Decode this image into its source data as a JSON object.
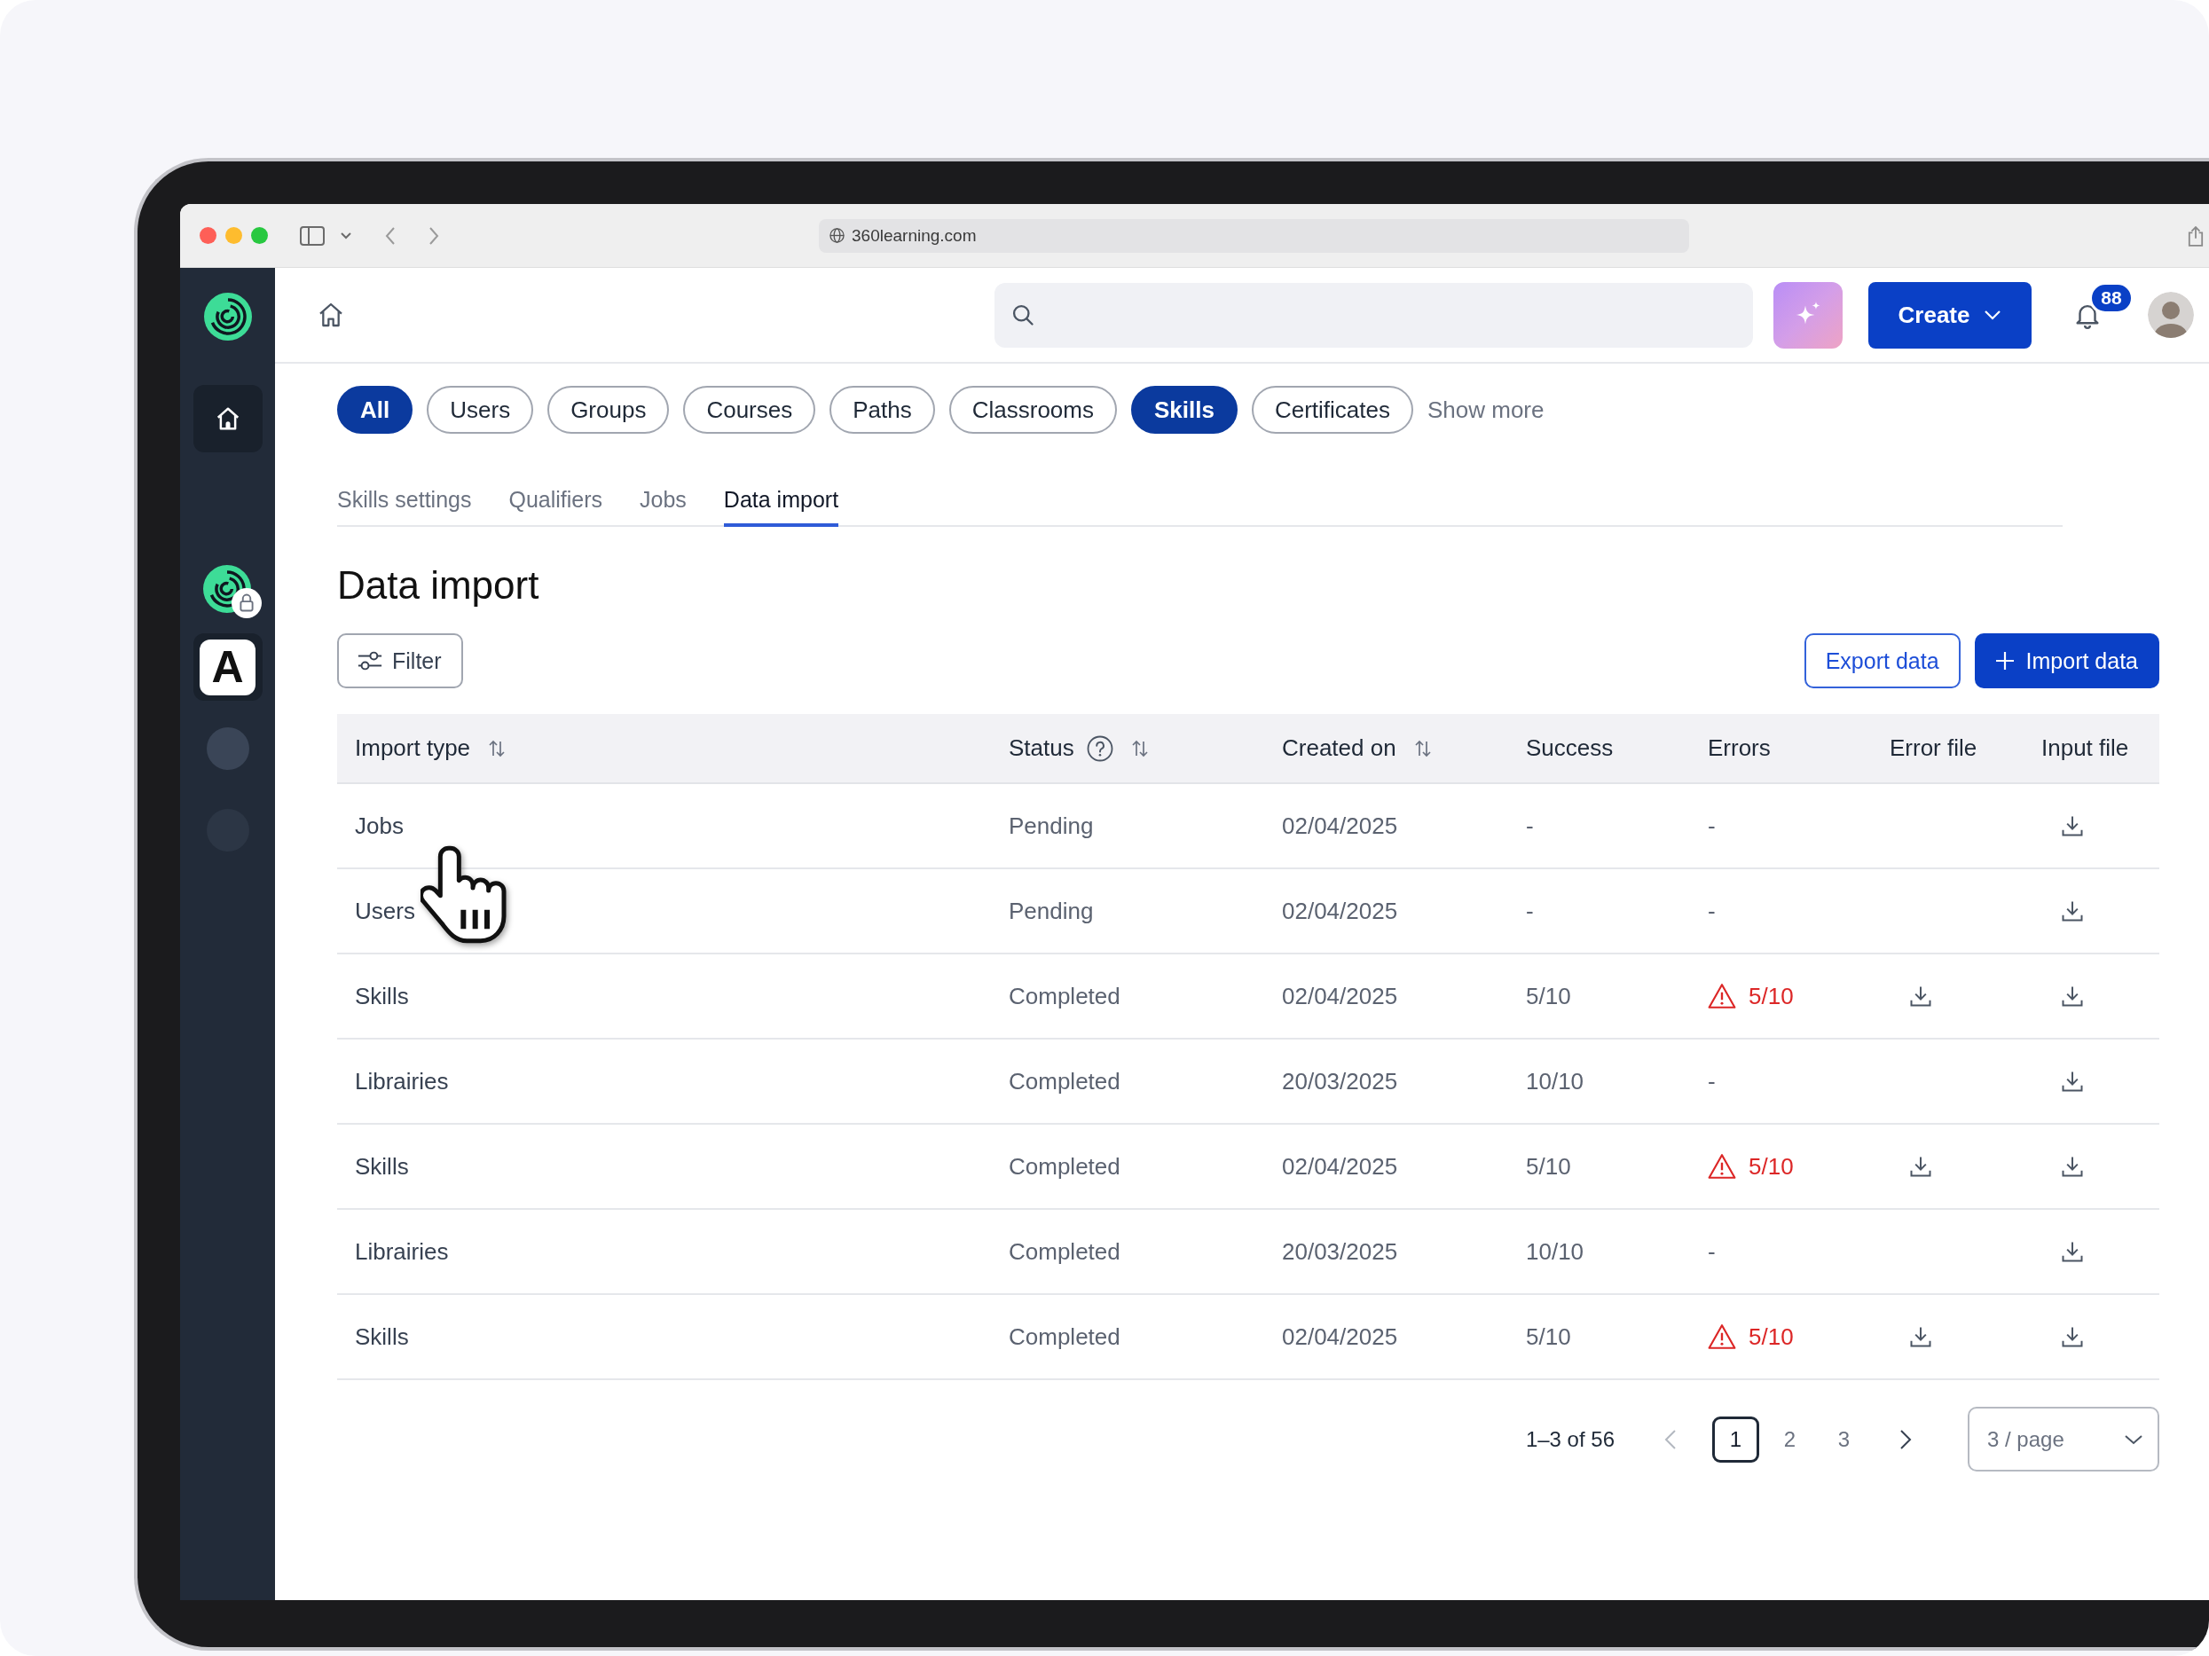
{
  "browser": {
    "url": "360learning.com"
  },
  "sidebar": {
    "items": [
      {
        "kind": "logo"
      },
      {
        "kind": "home",
        "selected": true
      },
      {
        "kind": "workspace",
        "locked": true,
        "selected": false
      },
      {
        "kind": "letter",
        "text": "A",
        "selected": true
      },
      {
        "kind": "blank",
        "selected": false
      },
      {
        "kind": "blank",
        "selected": false
      }
    ]
  },
  "topbar": {
    "create_button": "Create",
    "notification_count": "88"
  },
  "filters": [
    {
      "label": "All",
      "selected": true
    },
    {
      "label": "Users",
      "selected": false
    },
    {
      "label": "Groups",
      "selected": false
    },
    {
      "label": "Courses",
      "selected": false
    },
    {
      "label": "Paths",
      "selected": false
    },
    {
      "label": "Classrooms",
      "selected": false
    },
    {
      "label": "Skills",
      "selected": true
    },
    {
      "label": "Certificates",
      "selected": false
    }
  ],
  "show_more": "Show more",
  "tabs": [
    {
      "label": "Skills settings",
      "selected": false
    },
    {
      "label": "Qualifiers",
      "selected": false
    },
    {
      "label": "Jobs",
      "selected": false
    },
    {
      "label": "Data import",
      "selected": true
    }
  ],
  "page_title": "Data import",
  "toolbar": {
    "filter_button": "Filter",
    "actions": [
      {
        "label": "Export data",
        "kind": "secondary"
      },
      {
        "label": "Import data",
        "kind": "primary"
      }
    ]
  },
  "table": {
    "columns": [
      {
        "label": "Import type",
        "sortable": true,
        "help": false
      },
      {
        "label": "Status",
        "sortable": true,
        "help": true
      },
      {
        "label": "Created on",
        "sortable": true,
        "help": false
      },
      {
        "label": "Success",
        "sortable": false,
        "help": false
      },
      {
        "label": "Errors",
        "sortable": false,
        "help": false
      },
      {
        "label": "Error file",
        "sortable": false,
        "help": false
      },
      {
        "label": "Input file",
        "sortable": false,
        "help": false
      }
    ],
    "rows": [
      {
        "import_type": "Jobs",
        "status": "Pending",
        "created_on": "02/04/2025",
        "success": "-",
        "errors": {
          "value": "-",
          "warning": false
        },
        "error_file": false,
        "input_file": true
      },
      {
        "import_type": "Users",
        "status": "Pending",
        "created_on": "02/04/2025",
        "success": "-",
        "errors": {
          "value": "-",
          "warning": false
        },
        "error_file": false,
        "input_file": true
      },
      {
        "import_type": "Skills",
        "status": "Completed",
        "created_on": "02/04/2025",
        "success": "5/10",
        "errors": {
          "value": "5/10",
          "warning": true
        },
        "error_file": true,
        "input_file": true
      },
      {
        "import_type": "Librairies",
        "status": "Completed",
        "created_on": "20/03/2025",
        "success": "10/10",
        "errors": {
          "value": "-",
          "warning": false
        },
        "error_file": false,
        "input_file": true
      },
      {
        "import_type": "Skills",
        "status": "Completed",
        "created_on": "02/04/2025",
        "success": "5/10",
        "errors": {
          "value": "5/10",
          "warning": true
        },
        "error_file": true,
        "input_file": true
      },
      {
        "import_type": "Librairies",
        "status": "Completed",
        "created_on": "20/03/2025",
        "success": "10/10",
        "errors": {
          "value": "-",
          "warning": false
        },
        "error_file": false,
        "input_file": true
      },
      {
        "import_type": "Skills",
        "status": "Completed",
        "created_on": "02/04/2025",
        "success": "5/10",
        "errors": {
          "value": "5/10",
          "warning": true
        },
        "error_file": true,
        "input_file": true
      }
    ]
  },
  "pagination": {
    "summary": "1–3 of 56",
    "pages": [
      {
        "label": "1",
        "selected": true
      },
      {
        "label": "2",
        "selected": false
      },
      {
        "label": "3",
        "selected": false
      }
    ],
    "page_size": "3 / page"
  }
}
